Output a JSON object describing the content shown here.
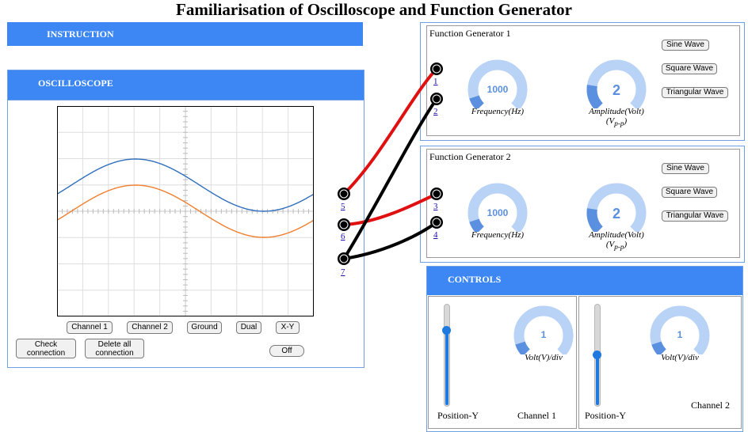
{
  "page": {
    "title": "Familiarisation of Oscilloscope and Function Generator"
  },
  "instruction": {
    "label": "INSTRUCTION"
  },
  "oscilloscope": {
    "label": "OSCILLOSCOPE",
    "buttons": {
      "channel1": "Channel 1",
      "channel2": "Channel 2",
      "ground": "Ground",
      "dual": "Dual",
      "xy": "X-Y",
      "off": "Off",
      "check_connection_line1": "Check",
      "check_connection_line2": "connection",
      "delete_all_line1": "Delete all",
      "delete_all_line2": "connection"
    },
    "terminals": [
      "5",
      "6",
      "7"
    ],
    "trace_colors": {
      "channel1": "#2f6fbd",
      "channel2": "#f07f2e"
    }
  },
  "function_generator_1": {
    "title": "Function Generator 1",
    "terminals": [
      "1",
      "2"
    ],
    "frequency": {
      "value": "1000",
      "label": "Frequency(Hz)",
      "level": 0.1
    },
    "amplitude": {
      "value": "2",
      "label_line1": "Amplitude(Volt)",
      "label_main": "(V",
      "label_sub": "p-p",
      "label_end": ")",
      "level": 0.2
    },
    "buttons": {
      "sine": "Sine Wave",
      "square": "Square Wave",
      "triangular": "Triangular Wave"
    }
  },
  "function_generator_2": {
    "title": "Function Generator 2",
    "terminals": [
      "3",
      "4"
    ],
    "frequency": {
      "value": "1000",
      "label": "Frequency(Hz)",
      "level": 0.1
    },
    "amplitude": {
      "value": "2",
      "label_line1": "Amplitude(Volt)",
      "label_main": "(V",
      "label_sub": "p-p",
      "label_end": ")",
      "level": 0.2
    },
    "buttons": {
      "sine": "Sine Wave",
      "square": "Square Wave",
      "triangular": "Triangular Wave"
    }
  },
  "controls": {
    "label": "CONTROLS",
    "channel1": {
      "name": "Channel 1",
      "position_label": "Position-Y",
      "volt_label": "Volt(V)/div",
      "volt_value": "1",
      "position_level": 0.75,
      "volt_level": 0.1
    },
    "channel2": {
      "name": "Channel 2",
      "position_label": "Position-Y",
      "volt_label": "Volt(V)/div",
      "volt_value": "1",
      "position_level": 0.5,
      "volt_level": 0.1
    }
  },
  "colors": {
    "accent": "#3d87f5",
    "wire_red": "#e01010",
    "wire_black": "#000000",
    "gauge_light": "#b9d3f7",
    "gauge_dark": "#5b8fe0",
    "gauge_text": "#5b8fe0"
  }
}
